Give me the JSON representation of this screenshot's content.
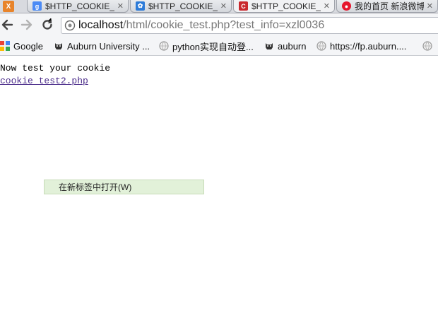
{
  "tabs": [
    {
      "title": "$HTTP_COOKIE_",
      "close": "✕"
    },
    {
      "title": "$HTTP_COOKIE_",
      "close": "✕"
    },
    {
      "title": "$HTTP_COOKIE_",
      "close": "✕"
    },
    {
      "title": "我的首页 新浪微博",
      "close": "✕"
    }
  ],
  "toolbar": {
    "url_host": "localhost",
    "url_path": "/html/cookie_test.php?test_info=xzl0036"
  },
  "bookmarks": [
    {
      "label": "Google"
    },
    {
      "label": "Auburn University ..."
    },
    {
      "label": "python实现自动登..."
    },
    {
      "label": "auburn"
    },
    {
      "label": "https://fp.auburn...."
    }
  ],
  "page": {
    "heading": "Now test your cookie",
    "link_text": "cookie_test2.php"
  },
  "context_menu": {
    "item": "在新标签中打开(W)"
  },
  "colors": {
    "tab_strip": "#d8dadf",
    "toolbar": "#f4f5f7",
    "link": "#4b2c8a",
    "context_highlight": "#e2f1d9"
  }
}
